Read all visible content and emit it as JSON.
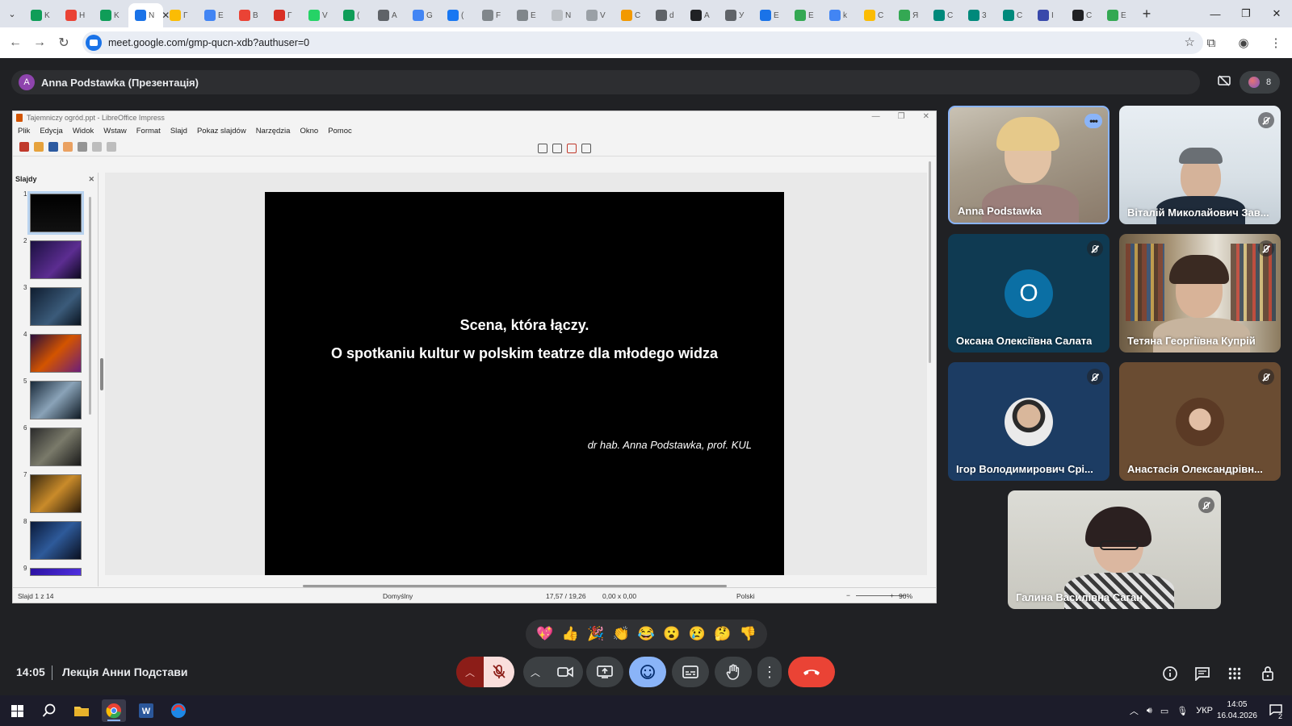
{
  "browser": {
    "tabs": [
      {
        "title": "K",
        "color": "#0f9d58"
      },
      {
        "title": "H",
        "color": "#ea4335"
      },
      {
        "title": "K",
        "color": "#0f9d58"
      },
      {
        "title": "N",
        "color": "#1a73e8",
        "active": true
      },
      {
        "title": "Г",
        "color": "#fbbc04"
      },
      {
        "title": "E",
        "color": "#4285f4"
      },
      {
        "title": "B",
        "color": "#ea4335"
      },
      {
        "title": "Г",
        "color": "#d93025"
      },
      {
        "title": "V",
        "color": "#25d366"
      },
      {
        "title": "(",
        "color": "#0f9d58"
      },
      {
        "title": "A",
        "color": "#5f6368"
      },
      {
        "title": "G",
        "color": "#4285f4"
      },
      {
        "title": "(",
        "color": "#1877f2"
      },
      {
        "title": "F",
        "color": "#80868b"
      },
      {
        "title": "E",
        "color": "#80868b"
      },
      {
        "title": "N",
        "color": "#bdc1c6"
      },
      {
        "title": "V",
        "color": "#9aa0a6"
      },
      {
        "title": "C",
        "color": "#f29900"
      },
      {
        "title": "d",
        "color": "#5f6368"
      },
      {
        "title": "A",
        "color": "#202124"
      },
      {
        "title": "У",
        "color": "#5f6368"
      },
      {
        "title": "E",
        "color": "#1a73e8"
      },
      {
        "title": "E",
        "color": "#34a853"
      },
      {
        "title": "k",
        "color": "#4285f4"
      },
      {
        "title": "C",
        "color": "#fbbc04"
      },
      {
        "title": "Я",
        "color": "#34a853"
      },
      {
        "title": "C",
        "color": "#00897b"
      },
      {
        "title": "3",
        "color": "#00897b"
      },
      {
        "title": "C",
        "color": "#00897b"
      },
      {
        "title": "I",
        "color": "#3949ab"
      },
      {
        "title": "C",
        "color": "#202124"
      },
      {
        "title": "E",
        "color": "#34a853"
      }
    ],
    "url": "meet.google.com/gmp-qucn-xdb?authuser=0"
  },
  "presenter": {
    "avatar_letter": "A",
    "label": "Anna Podstawka (Презентація)",
    "participant_count": "8"
  },
  "impress": {
    "window_title": "Tajemniczy ogród.ppt - LibreOffice Impress",
    "menu": [
      "Plik",
      "Edycja",
      "Widok",
      "Wstaw",
      "Format",
      "Slajd",
      "Pokaz slajdów",
      "Narzędzia",
      "Okno",
      "Pomoc"
    ],
    "slides_pane_title": "Slajdy",
    "slide_numbers": [
      "1",
      "2",
      "3",
      "4",
      "5",
      "6",
      "7",
      "8",
      "9"
    ],
    "slide": {
      "title_line1": "Scena, która łączy.",
      "title_line2": "O spotkaniu kultur w polskim teatrze dla młodego widza",
      "author": "dr hab. Anna Podstawka, prof. KUL"
    },
    "status": {
      "slide_counter": "Slajd 1 z 14",
      "layout": "Domyślny",
      "position": "17,57 / 19,26",
      "size": "0,00 x 0,00",
      "language": "Polski",
      "zoom": "90%"
    }
  },
  "participants": [
    {
      "name": "Anna Podstawka",
      "avatar_letter": ""
    },
    {
      "name": "Віталій Миколайович Зав...",
      "avatar_letter": ""
    },
    {
      "name": "Оксана Олексіївна Салата",
      "avatar_letter": "О"
    },
    {
      "name": "Тетяна Георгіївна Купрій",
      "avatar_letter": ""
    },
    {
      "name": "Ігор Володимирович Срі...",
      "avatar_letter": ""
    },
    {
      "name": "Анастасія Олександрівн...",
      "avatar_letter": ""
    },
    {
      "name": "Галина Василівна Саган",
      "avatar_letter": ""
    }
  ],
  "reactions": [
    "💖",
    "👍",
    "🎉",
    "👏",
    "😂",
    "😮",
    "😢",
    "🤔",
    "👎"
  ],
  "meeting": {
    "time": "14:05",
    "title": "Лекція Анни Подстави"
  },
  "controls": {
    "accent_red": "#ea4335",
    "mic_muted_bg": "#f9dedc",
    "active_blue": "#8ab4f8"
  },
  "taskbar": {
    "language": "УКР",
    "time": "14:05",
    "date": "16.04.2026",
    "notifications": "2"
  }
}
